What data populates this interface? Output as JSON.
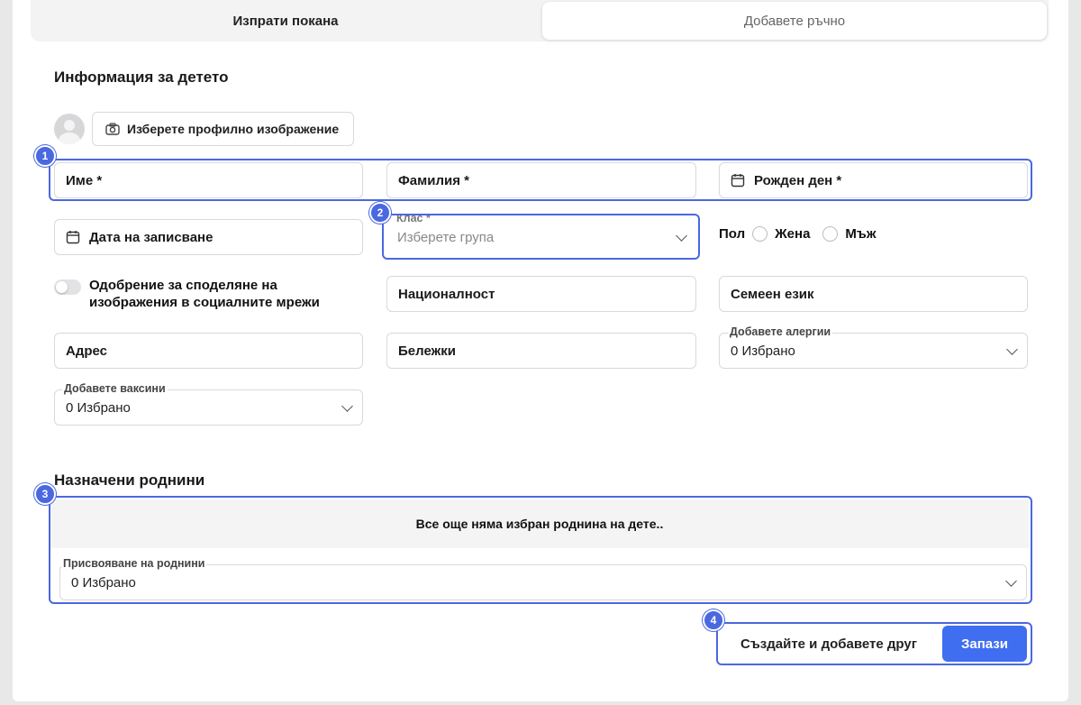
{
  "tabs": {
    "invite": "Изпрати покана",
    "manual": "Добавете ръчно"
  },
  "child_section": {
    "title": "Информация за детето",
    "choose_image": "Изберете профилно изображение",
    "first_name": "Име *",
    "last_name": "Фамилия *",
    "birthday": "Рожден ден *",
    "enroll_date": "Дата на записване",
    "class_label": "Клас *",
    "class_placeholder": "Изберете група",
    "gender_label": "Пол",
    "gender_female": "Жена",
    "gender_male": "Мъж",
    "social_consent": "Одобрение за споделяне на изображения в социалните мрежи",
    "nationality": "Националност",
    "family_language": "Семеен език",
    "address": "Адрес",
    "notes": "Бележки",
    "allergies_label": "Добавете алергии",
    "allergies_value": "0 Избрано",
    "vaccines_label": "Добавете ваксини",
    "vaccines_value": "0 Избрано"
  },
  "relatives_section": {
    "title": "Назначени роднини",
    "empty_message": "Все още няма избран роднина на дете..",
    "assign_label": "Присвояване на роднини",
    "assign_value": "0 Избрано"
  },
  "actions": {
    "create_another": "Създайте и добавете друг",
    "save": "Запази"
  },
  "badges": [
    "1",
    "2",
    "3",
    "4"
  ],
  "colors": {
    "accent": "#4a68e0",
    "primary_button": "#3f6ef0"
  }
}
